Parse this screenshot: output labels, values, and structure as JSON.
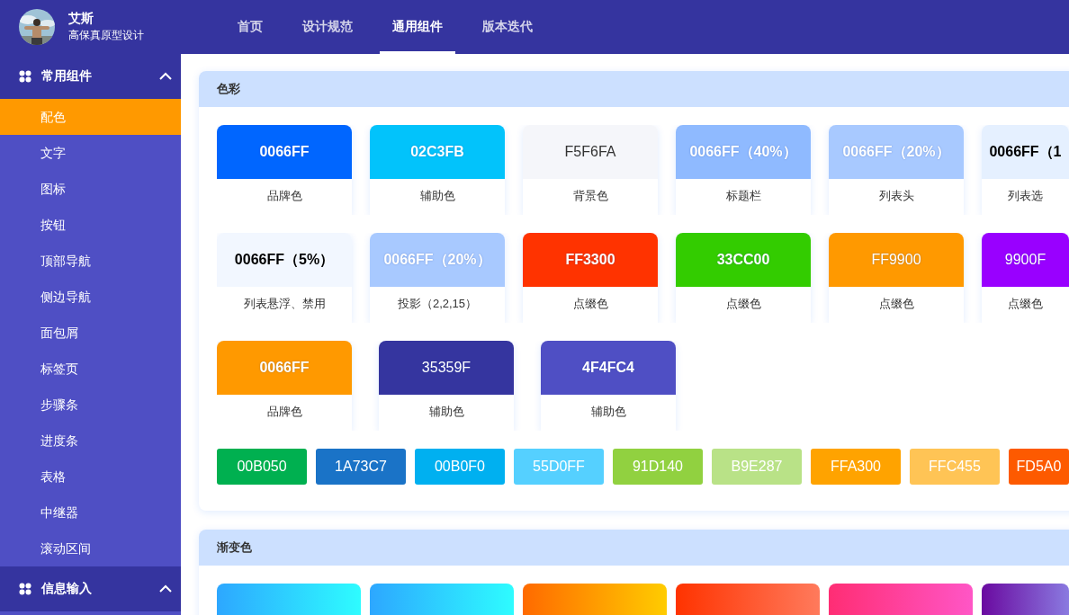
{
  "header": {
    "user": {
      "name": "艾斯",
      "subtitle": "高保真原型设计"
    },
    "tabs": [
      {
        "label": "首页",
        "selected": false
      },
      {
        "label": "设计规范",
        "selected": false
      },
      {
        "label": "通用组件",
        "selected": true
      },
      {
        "label": "版本迭代",
        "selected": false
      }
    ]
  },
  "sidebar": {
    "groups": [
      {
        "label": "常用组件",
        "expanded": true,
        "items": [
          {
            "label": "配色",
            "selected": true
          },
          {
            "label": "文字",
            "selected": false
          },
          {
            "label": "图标",
            "selected": false
          },
          {
            "label": "按钮",
            "selected": false
          },
          {
            "label": "顶部导航",
            "selected": false
          },
          {
            "label": "侧边导航",
            "selected": false
          },
          {
            "label": "面包屑",
            "selected": false
          },
          {
            "label": "标签页",
            "selected": false
          },
          {
            "label": "步骤条",
            "selected": false
          },
          {
            "label": "进度条",
            "selected": false
          },
          {
            "label": "表格",
            "selected": false
          },
          {
            "label": "中继器",
            "selected": false
          },
          {
            "label": "滚动区间",
            "selected": false
          }
        ]
      },
      {
        "label": "信息输入",
        "expanded": true
      }
    ]
  },
  "panels": [
    {
      "title": "色彩",
      "card_rows": [
        [
          {
            "code": "0066FF",
            "label": "品牌色",
            "color": "#0066ff",
            "bold": true,
            "dark_text": false
          },
          {
            "code": "02C3FB",
            "label": "辅助色",
            "color": "#02c3fb",
            "bold": true,
            "dark_text": false
          },
          {
            "code": "F5F6FA",
            "label": "背景色",
            "color": "#f5f6fa",
            "bold": false,
            "dark_text": true
          },
          {
            "code": "0066FF（40%）",
            "label": "标题栏",
            "color": "#8fbaff",
            "bold": true,
            "dark_text": false
          },
          {
            "code": "0066FF（20%）",
            "label": "列表头",
            "color": "#a8c9ff",
            "bold": true,
            "dark_text": false
          },
          {
            "code": "0066FF（1",
            "label": "列表选",
            "color": "#e5f0ff",
            "bold": true,
            "dark_text": true
          }
        ],
        [
          {
            "code": "0066FF（5%）",
            "label": "列表悬浮、禁用",
            "color": "#f2f7ff",
            "bold": true,
            "dark_text": true
          },
          {
            "code": "0066FF（20%）",
            "label": "投影（2,2,15）",
            "color": "#a8c9ff",
            "bold": true,
            "dark_text": false
          },
          {
            "code": "FF3300",
            "label": "点缀色",
            "color": "#ff3300",
            "bold": true,
            "dark_text": false
          },
          {
            "code": "33CC00",
            "label": "点缀色",
            "color": "#33cc00",
            "bold": true,
            "dark_text": false
          },
          {
            "code": "FF9900",
            "label": "点缀色",
            "color": "#ff9900",
            "bold": false,
            "dark_text": false
          },
          {
            "code": "9900F",
            "label": "点缀色",
            "color": "#9900ff",
            "bold": false,
            "dark_text": false
          }
        ],
        [
          {
            "code": "0066FF",
            "label": "品牌色",
            "color": "#ff9900",
            "bold": true,
            "dark_text": false
          },
          {
            "code": "35359F",
            "label": "辅助色",
            "color": "#35359f",
            "bold": false,
            "dark_text": false
          },
          {
            "code": "4F4FC4",
            "label": "辅助色",
            "color": "#4f4fc4",
            "bold": true,
            "dark_text": false
          }
        ]
      ],
      "swatches": [
        {
          "code": "00B050",
          "color": "#00b050"
        },
        {
          "code": "1A73C7",
          "color": "#1a73c7"
        },
        {
          "code": "00B0F0",
          "color": "#00b0f0"
        },
        {
          "code": "55D0FF",
          "color": "#55d0ff"
        },
        {
          "code": "91D140",
          "color": "#91d140"
        },
        {
          "code": "B9E287",
          "color": "#b9e287"
        },
        {
          "code": "FFA300",
          "color": "#ffa300"
        },
        {
          "code": "FFC455",
          "color": "#ffc455"
        },
        {
          "code": "FD5A0",
          "color": "#fd5a00"
        }
      ]
    },
    {
      "title": "渐变色",
      "gradients": [
        {
          "stops": [
            {
              "color": "#2da7ff"
            },
            {
              "color": "#2efcff"
            }
          ]
        },
        {
          "stops": [
            {
              "color": "#2da7ff"
            },
            {
              "color": "#2efcff"
            }
          ]
        },
        {
          "stops": [
            {
              "color": "#ff6a00"
            },
            {
              "color": "#ffcc00"
            }
          ]
        },
        {
          "stops": [
            {
              "color": "#ff3300"
            },
            {
              "color": "#ff7a5c"
            }
          ]
        },
        {
          "stops": [
            {
              "color": "#ff2d74"
            },
            {
              "color": "#ff56c6"
            }
          ]
        },
        {
          "stops": [
            {
              "color": "#6a0aa0"
            },
            {
              "color": "#8a7ae0"
            }
          ]
        }
      ]
    }
  ]
}
